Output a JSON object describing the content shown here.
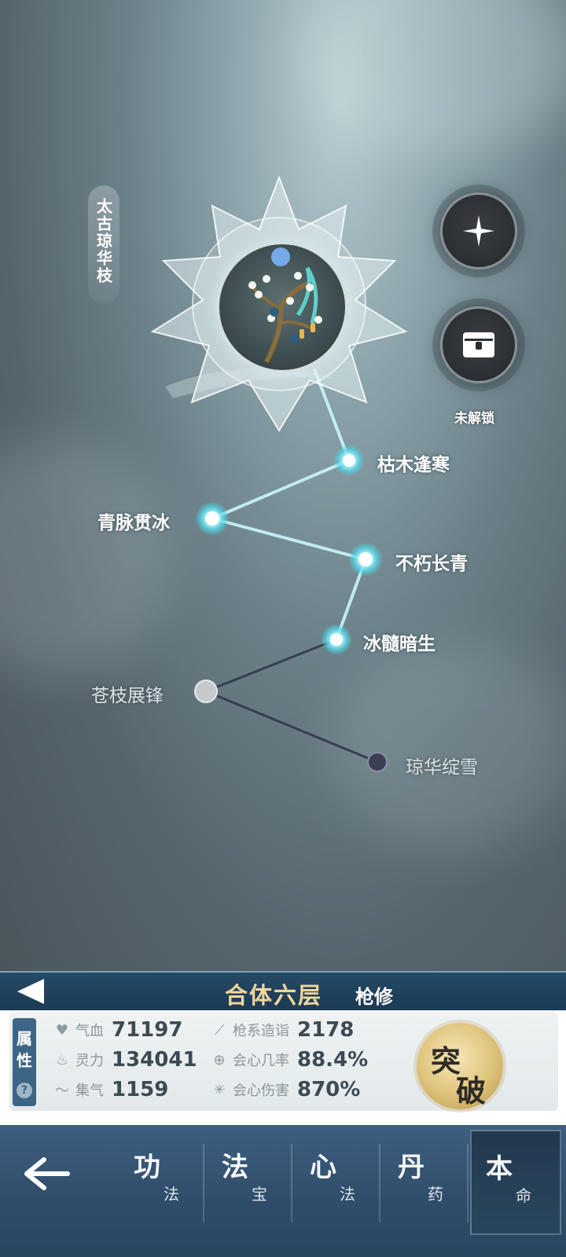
{
  "skill_tree": {
    "title": "太古琼华枝",
    "locked_label": "未解锁",
    "nodes": [
      {
        "label": "枯木逢寒",
        "state": "active"
      },
      {
        "label": "青脉贯冰",
        "state": "active"
      },
      {
        "label": "不朽长青",
        "state": "active"
      },
      {
        "label": "冰髓暗生",
        "state": "active"
      },
      {
        "label": "苍枝展锋",
        "state": "inactive"
      },
      {
        "label": "琼华绽雪",
        "state": "locked"
      }
    ]
  },
  "realm": {
    "name": "合体六层",
    "class": "枪修"
  },
  "attributes": {
    "tab_label_1": "属",
    "tab_label_2": "性",
    "help": "?",
    "stats": [
      {
        "icon": "heart-icon",
        "label": "气血",
        "value": "71197"
      },
      {
        "icon": "flame-icon",
        "label": "灵力",
        "value": "134041"
      },
      {
        "icon": "wind-icon",
        "label": "集气",
        "value": "1159"
      },
      {
        "icon": "spear-icon",
        "label": "枪系造诣",
        "value": "2178"
      },
      {
        "icon": "crit-rate-icon",
        "label": "会心几率",
        "value": "88.4%"
      },
      {
        "icon": "crit-damage-icon",
        "label": "会心伤害",
        "value": "870%"
      }
    ],
    "breakthrough_1": "突",
    "breakthrough_2": "破"
  },
  "nav": {
    "items": [
      {
        "big": "功",
        "small": "法"
      },
      {
        "big": "法",
        "small": "宝"
      },
      {
        "big": "心",
        "small": "法"
      },
      {
        "big": "丹",
        "small": "药"
      },
      {
        "big": "本",
        "small": "命"
      }
    ],
    "active_index": 4
  },
  "colors": {
    "accent_gold": "#f2d79c",
    "node_glow": "#7ff0ff",
    "header_blue": "#254a66"
  }
}
